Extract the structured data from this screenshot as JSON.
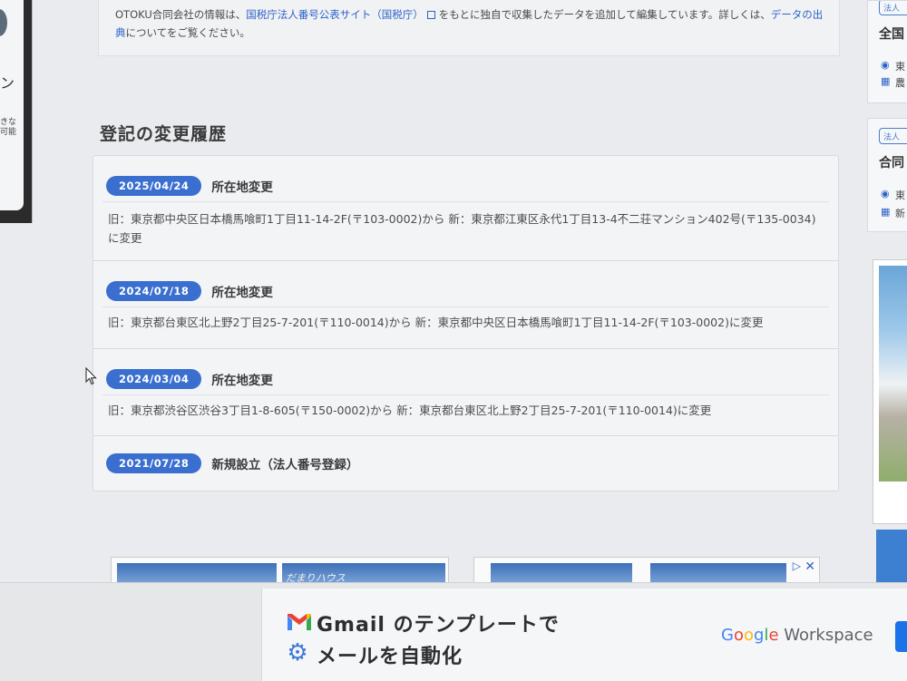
{
  "left_ad": {
    "big_text": "ン",
    "small_text": "きな 可能"
  },
  "info": {
    "text_before": "OTOKU合同会社の情報は、",
    "link1": "国税庁法人番号公表サイト（国税庁）",
    "text_middle": "をもとに独自で収集したデータを追加して編集しています。詳しくは、",
    "link2": "データの出典",
    "text_after": "についてをご覧ください。"
  },
  "section": {
    "title": "登記の変更履歴"
  },
  "history": [
    {
      "date": "2025/04/24",
      "type": "所在地変更",
      "detail": "旧：東京都中央区日本橋馬喰町1丁目11-14-2F(〒103-0002)から 新：東京都江東区永代1丁目13-4不二荘マンション402号(〒135-0034)に変更"
    },
    {
      "date": "2024/07/18",
      "type": "所在地変更",
      "detail": "旧：東京都台東区北上野2丁目25-7-201(〒110-0014)から 新：東京都中央区日本橋馬喰町1丁目11-14-2F(〒103-0002)に変更"
    },
    {
      "date": "2024/03/04",
      "type": "所在地変更",
      "detail": "旧：東京都渋谷区渋谷3丁目1-8-605(〒150-0002)から 新：東京都台東区北上野2丁目25-7-201(〒110-0014)に変更"
    },
    {
      "date": "2021/07/28",
      "type": "新規設立（法人番号登録）",
      "detail": ""
    }
  ],
  "right_cards": [
    {
      "badge": "法人",
      "title": "全国",
      "line1": "東",
      "line2": "農"
    },
    {
      "badge": "法人",
      "title": "合同",
      "line1": "東",
      "line2": "新"
    }
  ],
  "thumb_label": "だまりハウス",
  "bottom_ad": {
    "headline": "Gmail のテンプレートで",
    "subline": "メールを自動化",
    "brand_google": [
      "G",
      "o",
      "o",
      "g",
      "l",
      "e"
    ],
    "brand_workspace": " Workspace"
  },
  "colors": {
    "accent": "#3a6fd0",
    "link": "#2d63c8"
  }
}
